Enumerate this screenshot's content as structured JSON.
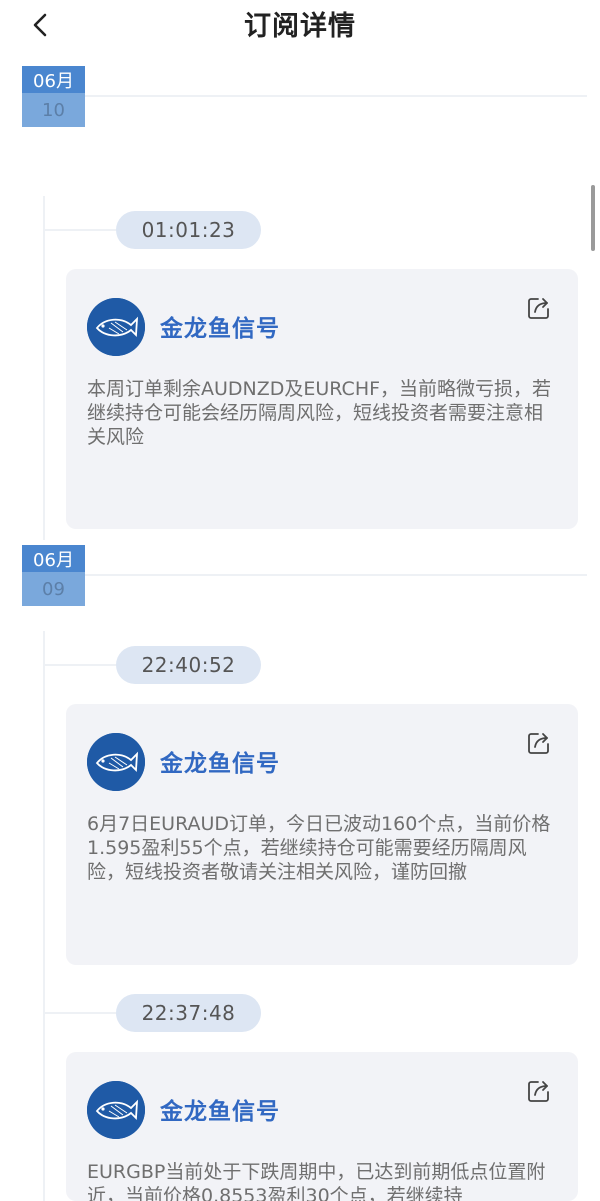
{
  "header": {
    "title": "订阅详情",
    "back_icon": "chevron-left-icon"
  },
  "groups": [
    {
      "month": "06月",
      "day": "10",
      "entries": [
        {
          "time": "01:01:23",
          "name": "金龙鱼信号",
          "message": "本周订单剩余AUDNZD及EURCHF，当前略微亏损，若继续持仓可能会经历隔周风险，短线投资者需要注意相关风险"
        }
      ]
    },
    {
      "month": "06月",
      "day": "09",
      "entries": [
        {
          "time": "22:40:52",
          "name": "金龙鱼信号",
          "message": "6月7日EURAUD订单，今日已波动160个点，当前价格1.595盈利55个点，若继续持仓可能需要经历隔周风险，短线投资者敬请关注相关风险，谨防回撤"
        },
        {
          "time": "22:37:48",
          "name": "金龙鱼信号",
          "message": "EURGBP当前处于下跌周期中，已达到前期低点位置附近，当前价格0.8553盈利30个点，若继续持"
        }
      ]
    }
  ],
  "colors": {
    "accent": "#3168c2",
    "badge_month": "#4a86cf",
    "badge_day": "#7aa8dc",
    "pill": "#dde6f3",
    "card": "#f2f3f7"
  }
}
